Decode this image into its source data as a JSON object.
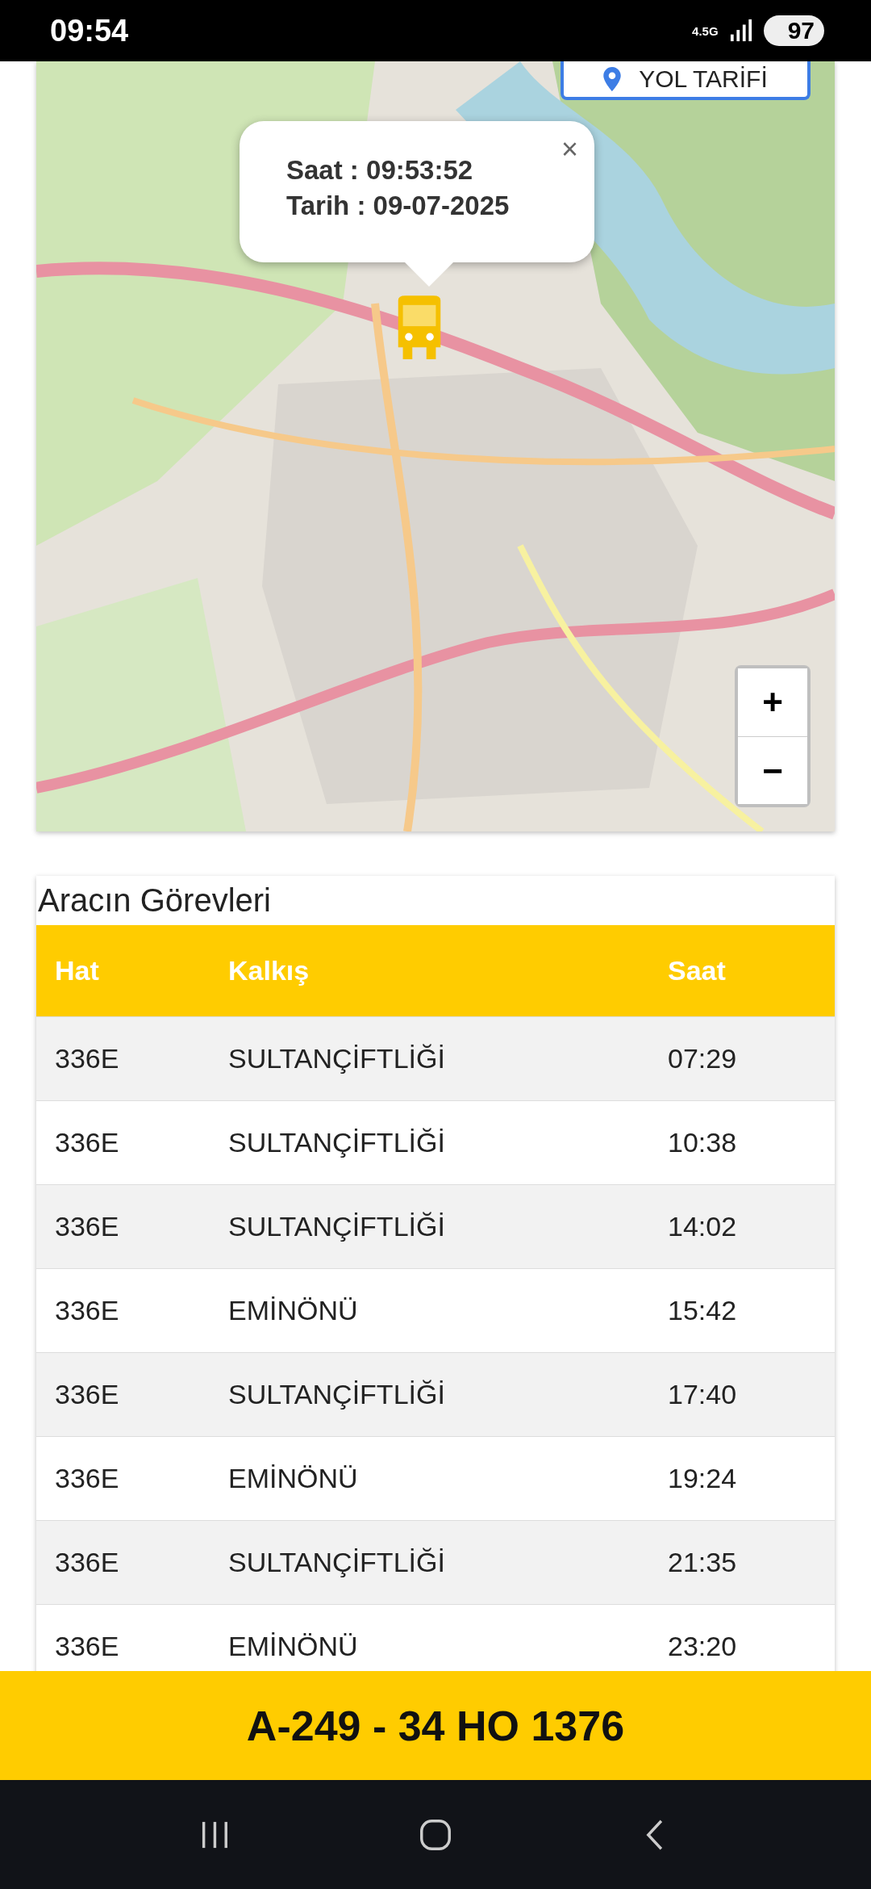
{
  "status_bar": {
    "time": "09:54",
    "network": "4.5G",
    "battery": "97"
  },
  "map": {
    "kind": "picture",
    "directions_button": "YOL TARİFİ",
    "popup": {
      "lines": [
        "Saat : 09:53:52",
        "Tarih : 09-07-2025"
      ],
      "close": "×"
    },
    "zoom_in": "+",
    "zoom_out": "−"
  },
  "table": {
    "title": "Aracın Görevleri",
    "columns": [
      "Hat",
      "Kalkış",
      "Saat"
    ],
    "rows": [
      [
        "336E",
        "SULTANÇİFTLİĞİ",
        "07:29"
      ],
      [
        "336E",
        "SULTANÇİFTLİĞİ",
        "10:38"
      ],
      [
        "336E",
        "SULTANÇİFTLİĞİ",
        "14:02"
      ],
      [
        "336E",
        "EMİNÖNÜ",
        "15:42"
      ],
      [
        "336E",
        "SULTANÇİFTLİĞİ",
        "17:40"
      ],
      [
        "336E",
        "EMİNÖNÜ",
        "19:24"
      ],
      [
        "336E",
        "SULTANÇİFTLİĞİ",
        "21:35"
      ],
      [
        "336E",
        "EMİNÖNÜ",
        "23:20"
      ]
    ]
  },
  "vehicle_bar": {
    "title": "A-249 - 34 HO 1376"
  }
}
